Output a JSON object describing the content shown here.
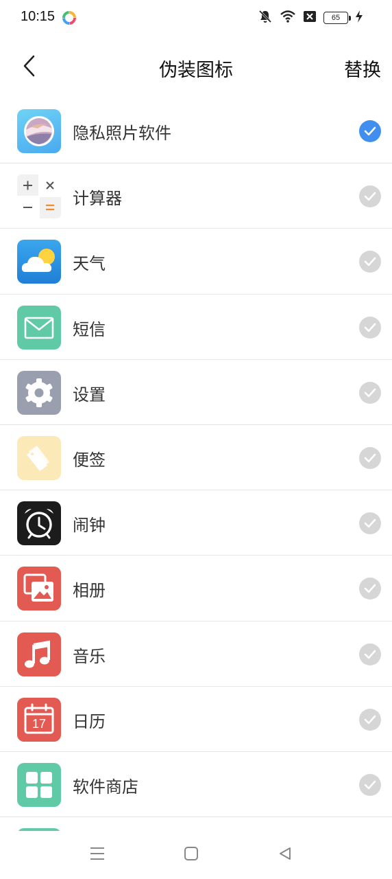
{
  "status_bar": {
    "time": "10:15",
    "battery": "65",
    "icons": [
      "app-logo-icon",
      "mute-icon",
      "wifi-icon",
      "no-sim-icon",
      "battery-icon",
      "charging-icon"
    ]
  },
  "header": {
    "title": "伪装图标",
    "action_label": "替换",
    "back_icon": "chevron-left-icon"
  },
  "icons": [
    {
      "label": "隐私照片软件",
      "icon": "private-photo-icon",
      "selected": true
    },
    {
      "label": "计算器",
      "icon": "calculator-icon",
      "selected": false
    },
    {
      "label": "天气",
      "icon": "weather-icon",
      "selected": false
    },
    {
      "label": "短信",
      "icon": "message-icon",
      "selected": false
    },
    {
      "label": "设置",
      "icon": "settings-icon",
      "selected": false
    },
    {
      "label": "便签",
      "icon": "notes-icon",
      "selected": false
    },
    {
      "label": "闹钟",
      "icon": "alarm-icon",
      "selected": false
    },
    {
      "label": "相册",
      "icon": "gallery-icon",
      "selected": false
    },
    {
      "label": "音乐",
      "icon": "music-icon",
      "selected": false
    },
    {
      "label": "日历",
      "icon": "calendar-icon",
      "selected": false,
      "calendar_day": "17"
    },
    {
      "label": "软件商店",
      "icon": "app-store-icon",
      "selected": false
    }
  ],
  "nav_bar": {
    "icons": [
      "menu-icon",
      "home-square-icon",
      "back-triangle-icon"
    ]
  },
  "colors": {
    "selected": "#3f8ef0",
    "unselected": "#d6d6d6",
    "weather": "#2f8fe0",
    "message": "#5fcaa5",
    "settings": "#9a9fb0",
    "notes": "#fbe9b8",
    "alarm": "#1c1c1c",
    "gallery": "#e25a52",
    "music": "#e25a52",
    "calendar": "#e25a52",
    "app_store": "#5fcaa5"
  }
}
